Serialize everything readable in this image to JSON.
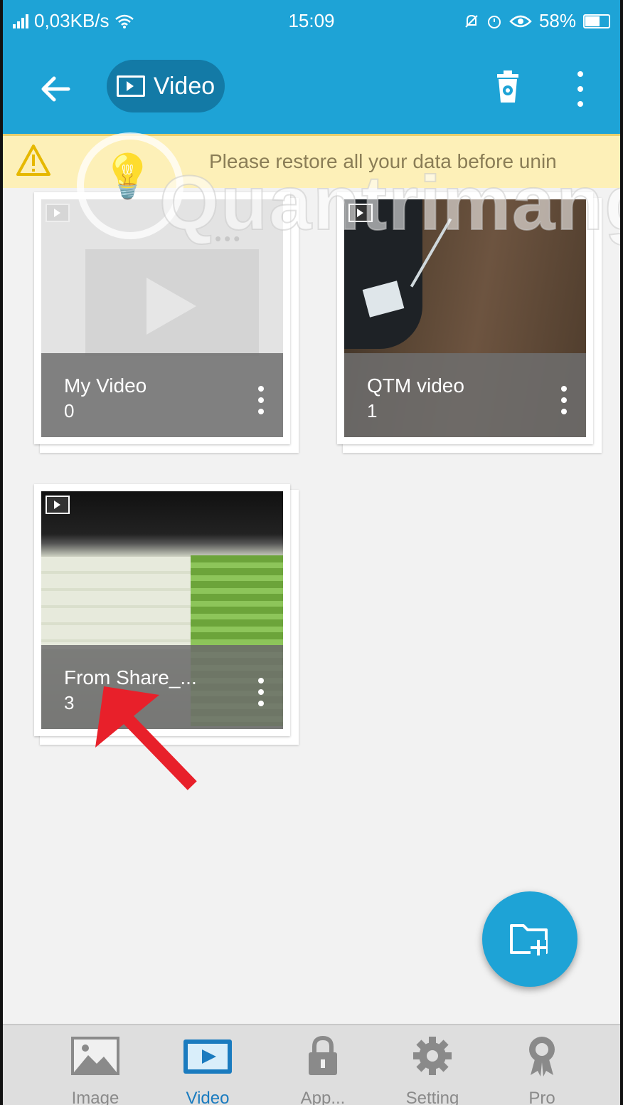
{
  "status_bar": {
    "network_speed": "0,03KB/s",
    "time": "15:09",
    "battery": "58%"
  },
  "app_bar": {
    "title": "Video"
  },
  "banner": {
    "text": "Please restore all your data before unin"
  },
  "watermark": {
    "text": "Quantrimang"
  },
  "folders": [
    {
      "name": "My Video",
      "count": "0"
    },
    {
      "name": "QTM video",
      "count": "1"
    },
    {
      "name": "From Share_...",
      "count": "3"
    }
  ],
  "bottom_nav": {
    "items": [
      {
        "label": "Image",
        "icon": "image-icon"
      },
      {
        "label": "Video",
        "icon": "video-icon"
      },
      {
        "label": "App...",
        "icon": "lock-icon"
      },
      {
        "label": "Setting",
        "icon": "gear-icon"
      },
      {
        "label": "Pro",
        "icon": "award-icon"
      }
    ],
    "active": "Video"
  },
  "colors": {
    "primary": "#1ea3d6",
    "chip": "#137aa6",
    "banner_bg": "#fdf0b8",
    "active_nav": "#1a7bbf",
    "annotation_arrow": "#e8202a"
  }
}
